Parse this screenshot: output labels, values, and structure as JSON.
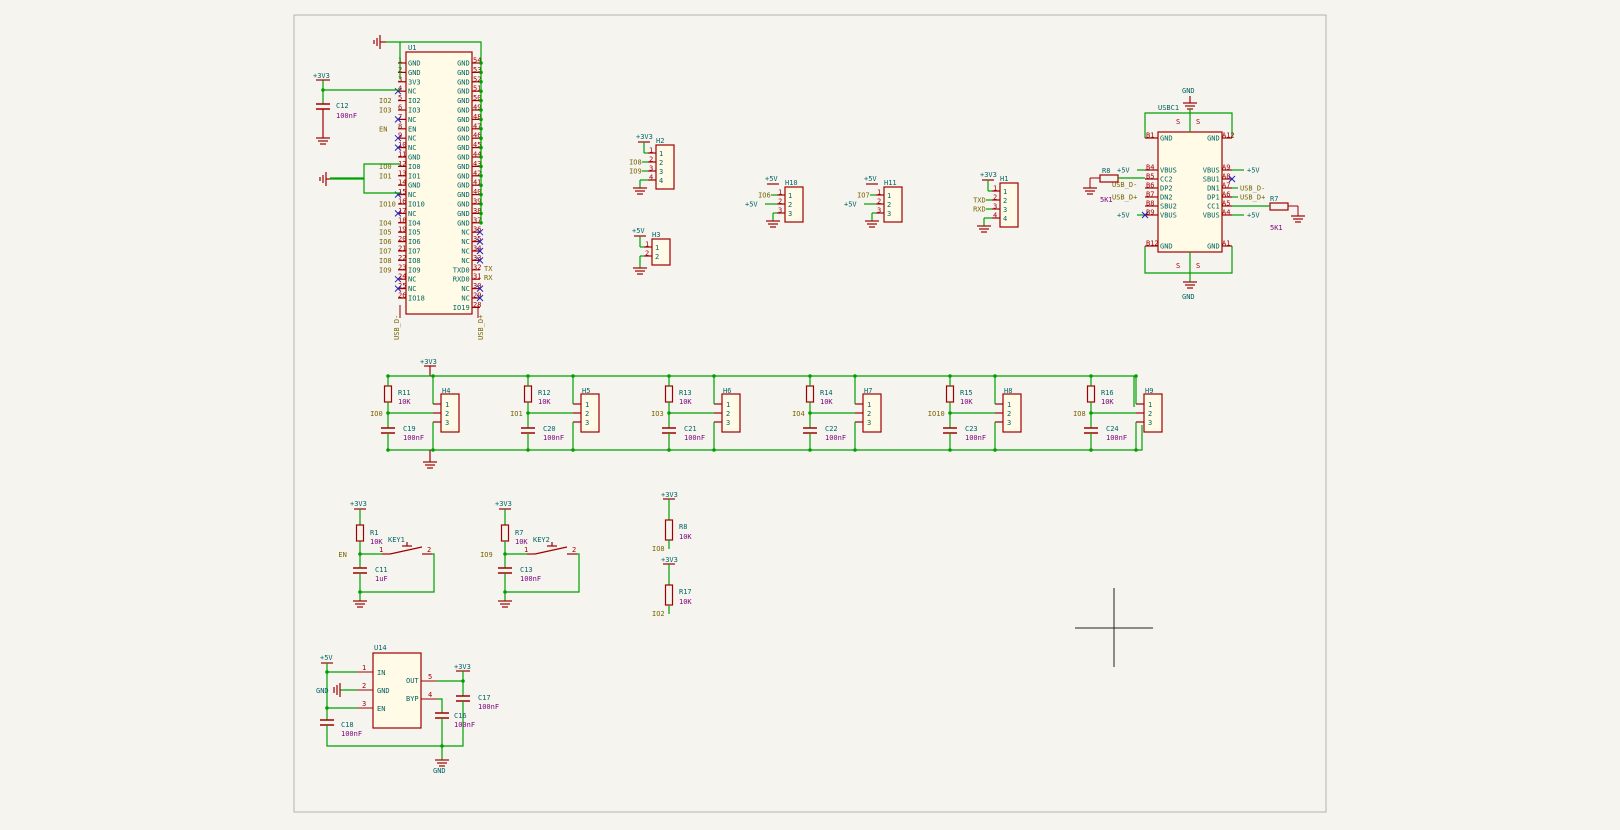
{
  "colors": {
    "background": "#f5f4ef",
    "sheet_border": "#b4b4aa",
    "wire": "#00a000",
    "component": "#a00000",
    "body_fill": "#fffbe6",
    "ref_text": "#006464",
    "value_text": "#7a007a",
    "net_label": "#7a6400",
    "no_connect": "#2020c0"
  },
  "u1": {
    "ref": "U1",
    "left_pins": [
      "GND",
      "GND",
      "3V3",
      "NC",
      "IO2",
      "IO3",
      "NC",
      "EN",
      "NC",
      "NC",
      "GND",
      "IO0",
      "IO1",
      "GND",
      "NC",
      "IO10",
      "NC",
      "IO4",
      "IO5",
      "IO6",
      "IO7",
      "IO8",
      "IO9",
      "NC",
      "NC",
      "IO18"
    ],
    "right_pins": [
      "GND",
      "GND",
      "GND",
      "GND",
      "GND",
      "GND",
      "GND",
      "GND",
      "GND",
      "GND",
      "GND",
      "GND",
      "GND",
      "GND",
      "GND",
      "GND",
      "GND",
      "GND",
      "NC",
      "NC",
      "NC",
      "NC",
      "TXD0",
      "RXD0",
      "NC",
      "NC",
      "IO19"
    ],
    "left_nets": {
      "IO2": "IO2",
      "IO3": "IO3",
      "EN": "EN",
      "IO0": "IO0",
      "IO1": "IO1",
      "IO10": "IO10",
      "IO4": "IO4",
      "IO5": "IO5",
      "IO6": "IO6",
      "IO7": "IO7",
      "IO8": "IO8",
      "IO9": "IO9"
    },
    "bottom_left_net": "USB_D-",
    "bottom_right_net": "USB_D+",
    "tx_net": "TX",
    "rx_net": "RX"
  },
  "c12": {
    "ref": "C12",
    "value": "100nF",
    "power": "+3V3"
  },
  "headers_top": [
    {
      "ref": "H2",
      "power": "+3V3",
      "nets": [
        "IO8",
        "IO9"
      ],
      "pins": [
        "1",
        "2",
        "3",
        "4"
      ]
    },
    {
      "ref": "H3",
      "power": "+5V",
      "pins": [
        "1",
        "2"
      ]
    },
    {
      "ref": "H10",
      "power": "+5V",
      "nets": [
        "IO6"
      ],
      "pins": [
        "1",
        "2",
        "3"
      ]
    },
    {
      "ref": "H11",
      "power": "+5V",
      "nets": [
        "IO7"
      ],
      "pins": [
        "1",
        "2",
        "3"
      ]
    },
    {
      "ref": "H1",
      "power": "+3V3",
      "nets": [
        "TXD",
        "RXD"
      ],
      "pins": [
        "1",
        "2",
        "3",
        "4"
      ]
    }
  ],
  "usb": {
    "ref": "USBC1",
    "gnd": "GND",
    "left_pins": [
      "GND",
      "VBUS",
      "CC2",
      "DP2",
      "DN2",
      "SBU2",
      "VBUS",
      "GND"
    ],
    "right_pins": [
      "GND",
      "VBUS",
      "SBU1",
      "DN1",
      "DP1",
      "CC1",
      "VBUS",
      "GND"
    ],
    "left_nums": [
      "B1",
      "B4",
      "B5",
      "B6",
      "B7",
      "B8",
      "B9",
      "B12"
    ],
    "right_nums": [
      "A12",
      "A9",
      "A8",
      "A7",
      "A6",
      "A5",
      "A4",
      "A1"
    ],
    "vbus": "+5V",
    "net_dm": "USB_D-",
    "net_dp": "USB_D+",
    "r8": {
      "ref": "R8",
      "value": "5K1"
    },
    "r7": {
      "ref": "R7",
      "value": "5K1"
    }
  },
  "sensor_power": "+3V3",
  "sensor_channels": [
    {
      "r_ref": "R11",
      "r_val": "10K",
      "net": "IO0",
      "c_ref": "C19",
      "c_val": "100nF",
      "h_ref": "H4"
    },
    {
      "r_ref": "R12",
      "r_val": "10K",
      "net": "IO1",
      "c_ref": "C20",
      "c_val": "100nF",
      "h_ref": "H5"
    },
    {
      "r_ref": "R13",
      "r_val": "10K",
      "net": "IO3",
      "c_ref": "C21",
      "c_val": "100nF",
      "h_ref": "H6"
    },
    {
      "r_ref": "R14",
      "r_val": "10K",
      "net": "IO4",
      "c_ref": "C22",
      "c_val": "100nF",
      "h_ref": "H7"
    },
    {
      "r_ref": "R15",
      "r_val": "10K",
      "net": "IO10",
      "c_ref": "C23",
      "c_val": "100nF",
      "h_ref": "H8"
    },
    {
      "r_ref": "R16",
      "r_val": "10K",
      "net": "IO8",
      "c_ref": "C24",
      "c_val": "100nF",
      "h_ref": "H9"
    }
  ],
  "keys": [
    {
      "power": "+3V3",
      "r_ref": "R1",
      "r_val": "10K",
      "key_ref": "KEY1",
      "net": "EN",
      "c_ref": "C11",
      "c_val": "1uF"
    },
    {
      "power": "+3V3",
      "r_ref": "R7",
      "r_val": "10K",
      "key_ref": "KEY2",
      "net": "IO9",
      "c_ref": "C13",
      "c_val": "100nF"
    }
  ],
  "pullups": [
    {
      "power": "+3V3",
      "ref": "R8",
      "value": "10K",
      "net": "IO8"
    },
    {
      "power": "+3V3",
      "ref": "R17",
      "value": "10K",
      "net": "IO2"
    }
  ],
  "regulator": {
    "ref": "U14",
    "in_power": "+5V",
    "out_power": "+3V3",
    "gnd_label": "GND",
    "pins": {
      "in": "IN",
      "gnd": "GND",
      "en": "EN",
      "out": "OUT",
      "byp": "BYP"
    },
    "pin_nums": {
      "in": "1",
      "gnd": "2",
      "en": "3",
      "out": "5",
      "byp": "4"
    },
    "c18": {
      "ref": "C18",
      "value": "100nF"
    },
    "c16": {
      "ref": "C16",
      "value": "100nF"
    },
    "c17": {
      "ref": "C17",
      "value": "100nF"
    }
  }
}
